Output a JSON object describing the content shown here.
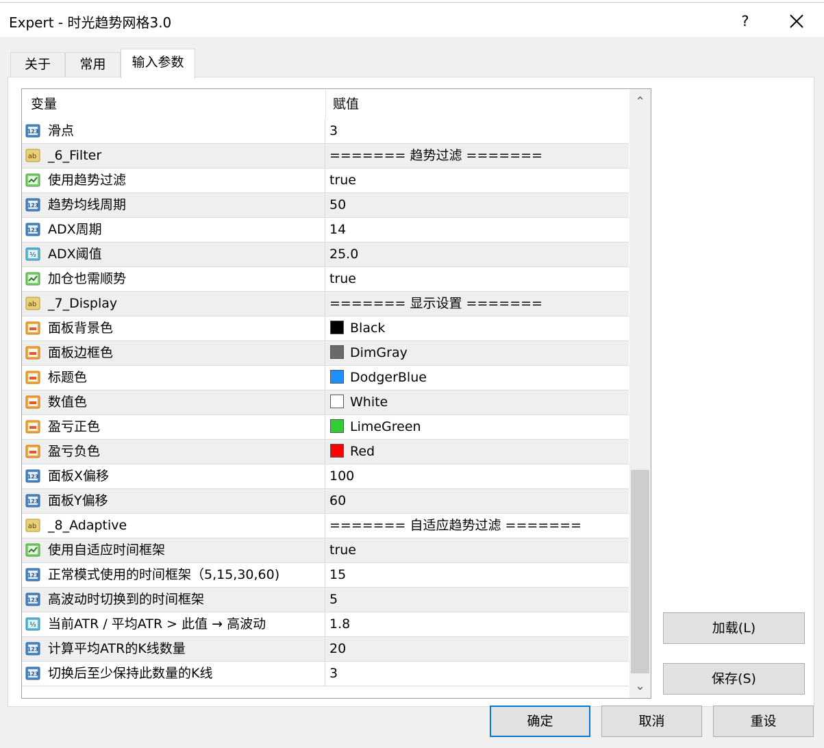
{
  "window": {
    "title": "Expert - 时光趋势网格3.0",
    "help_label": "?"
  },
  "tabs": [
    {
      "label": "关于"
    },
    {
      "label": "常用"
    },
    {
      "label": "输入参数"
    }
  ],
  "table": {
    "headers": {
      "variable": "变量",
      "value": "赋值"
    },
    "rows": [
      {
        "icon": "number-123-icon",
        "name": "滑点",
        "value": "3"
      },
      {
        "icon": "string-ab-icon",
        "name": "_6_Filter",
        "value": "======= 趋势过滤 ======="
      },
      {
        "icon": "boolean-icon",
        "name": "使用趋势过滤",
        "value": "true"
      },
      {
        "icon": "number-123-icon",
        "name": "趋势均线周期",
        "value": "50"
      },
      {
        "icon": "number-123-icon",
        "name": "ADX周期",
        "value": "14"
      },
      {
        "icon": "double-half-icon",
        "name": "ADX阈值",
        "value": "25.0"
      },
      {
        "icon": "boolean-icon",
        "name": "加仓也需顺势",
        "value": "true"
      },
      {
        "icon": "string-ab-icon",
        "name": "_7_Display",
        "value": "======= 显示设置 ======="
      },
      {
        "icon": "color-icon",
        "name": "面板背景色",
        "value": "Black",
        "color": "#000000"
      },
      {
        "icon": "color-icon",
        "name": "面板边框色",
        "value": "DimGray",
        "color": "#696969"
      },
      {
        "icon": "color-icon",
        "name": "标题色",
        "value": "DodgerBlue",
        "color": "#1e90ff"
      },
      {
        "icon": "color-icon",
        "name": "数值色",
        "value": "White",
        "color": "#ffffff"
      },
      {
        "icon": "color-icon",
        "name": "盈亏正色",
        "value": "LimeGreen",
        "color": "#32cd32"
      },
      {
        "icon": "color-icon",
        "name": "盈亏负色",
        "value": "Red",
        "color": "#ff0000"
      },
      {
        "icon": "number-123-icon",
        "name": "面板X偏移",
        "value": "100"
      },
      {
        "icon": "number-123-icon",
        "name": "面板Y偏移",
        "value": "60"
      },
      {
        "icon": "string-ab-icon",
        "name": "_8_Adaptive",
        "value": "======= 自适应趋势过滤 ======="
      },
      {
        "icon": "boolean-icon",
        "name": "使用自适应时间框架",
        "value": "true"
      },
      {
        "icon": "number-123-icon",
        "name": "正常模式使用的时间框架（5,15,30,60)",
        "value": "15"
      },
      {
        "icon": "number-123-icon",
        "name": "高波动时切换到的时间框架",
        "value": "5"
      },
      {
        "icon": "double-half-icon",
        "name": "当前ATR / 平均ATR > 此值 → 高波动",
        "value": "1.8"
      },
      {
        "icon": "number-123-icon",
        "name": "计算平均ATR的K线数量",
        "value": "20"
      },
      {
        "icon": "number-123-icon",
        "name": "切换后至少保持此数量的K线",
        "value": "3"
      }
    ]
  },
  "buttons": {
    "load": "加载(L)",
    "save": "保存(S)",
    "ok": "确定",
    "cancel": "取消",
    "reset": "重设"
  }
}
